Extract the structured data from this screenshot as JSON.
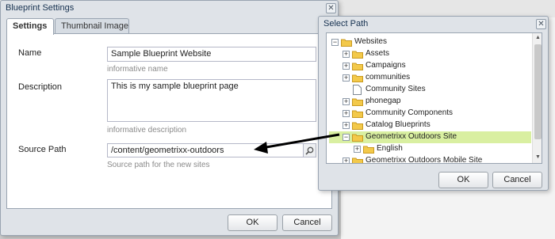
{
  "blueprint": {
    "title": "Blueprint Settings",
    "tabs": [
      "Settings",
      "Thumbnail Image"
    ],
    "name": {
      "label": "Name",
      "value": "Sample Blueprint Website",
      "hint": "informative name"
    },
    "description": {
      "label": "Description",
      "value": "This is my sample blueprint page",
      "hint": "informative description"
    },
    "source_path": {
      "label": "Source Path",
      "value": "/content/geometrixx-outdoors",
      "hint": "Source path for the new sites"
    },
    "ok_label": "OK",
    "cancel_label": "Cancel"
  },
  "select_path": {
    "title": "Select Path",
    "tree": [
      "Websites",
      "Assets",
      "Campaigns",
      "communities",
      "Community Sites",
      "phonegap",
      "Community Components",
      "Catalog Blueprints",
      "Geometrixx Outdoors Site",
      "English",
      "Geometrixx Outdoors Mobile Site"
    ],
    "ok_label": "OK",
    "cancel_label": "Cancel"
  },
  "colors": {
    "selected_row": "#d9efa1",
    "folder": "#f3c94a",
    "title_text": "#15304f"
  },
  "icons": [
    "close-icon",
    "folder-icon",
    "page-icon",
    "search-icon",
    "expand-icon",
    "collapse-icon",
    "arrow-icon"
  ]
}
